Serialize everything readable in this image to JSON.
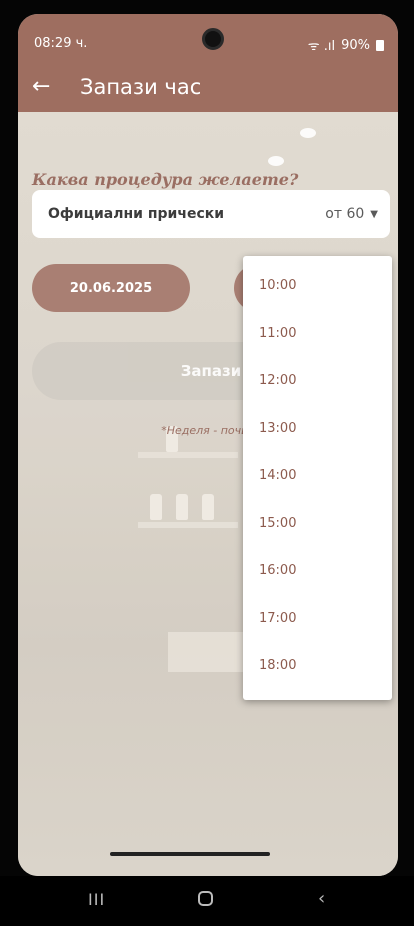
{
  "status_bar": {
    "time": "08:29 ч.",
    "signal": "ᯤ .ıl",
    "battery": "90%"
  },
  "app_bar": {
    "back": "←",
    "title": "Запази час"
  },
  "form": {
    "question": "Каква процедура желаете?",
    "service_name": "Официални прически",
    "service_price": "от 60",
    "caret": "▼",
    "date": "20.06.2025",
    "book_label": "Запази",
    "note": "*Неделя - почив"
  },
  "time_dropdown": {
    "options": [
      "10:00",
      "11:00",
      "12:00",
      "13:00",
      "14:00",
      "15:00",
      "16:00",
      "17:00",
      "18:00"
    ]
  },
  "nav_bar": {
    "recents": "III",
    "back": "‹"
  },
  "colors": {
    "accent": "#9e6e60",
    "accent_text": "#8c5a4d"
  }
}
